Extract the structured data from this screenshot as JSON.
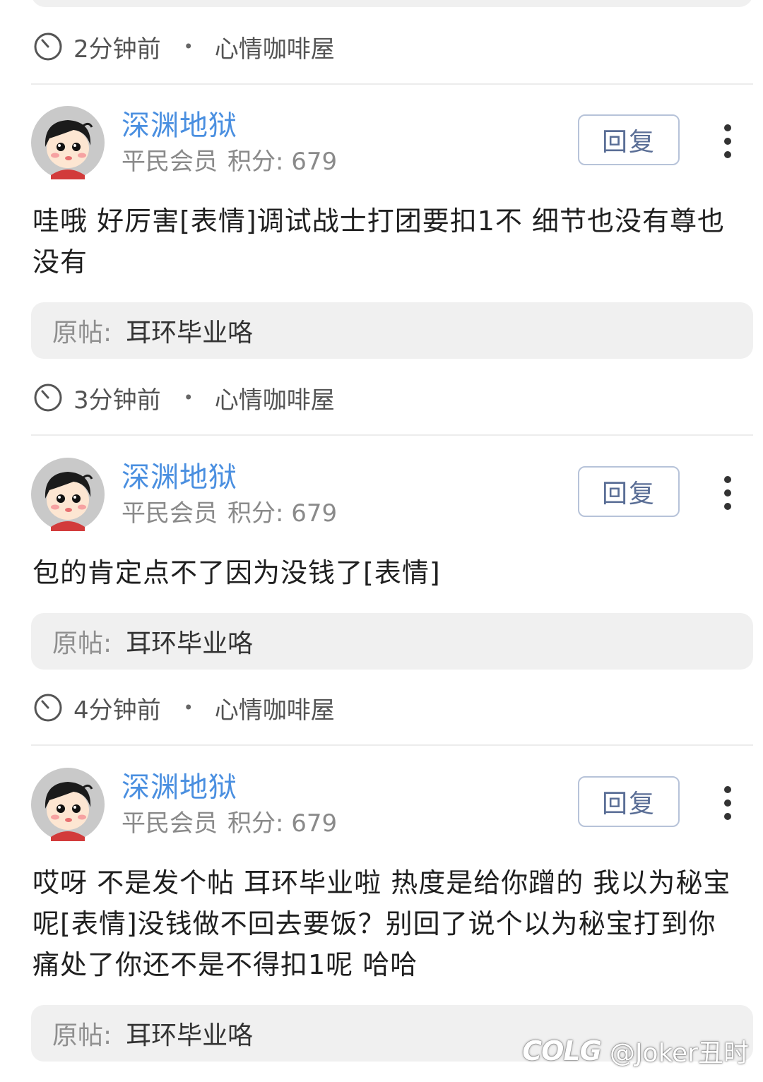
{
  "top": {
    "time": "2分钟前",
    "separator": "•",
    "board": "心情咖啡屋"
  },
  "comments": [
    {
      "username": "深渊地狱",
      "rank": "平民会员",
      "points_label": "积分:",
      "points": "679",
      "reply_label": "回复",
      "body": "哇哦 好厉害[表情]调试战士打团要扣1不 细节也没有尊也没有",
      "original_label": "原帖:",
      "original_title": "耳环毕业咯",
      "time": "3分钟前",
      "separator": "•",
      "board": "心情咖啡屋"
    },
    {
      "username": "深渊地狱",
      "rank": "平民会员",
      "points_label": "积分:",
      "points": "679",
      "reply_label": "回复",
      "body": "包的肯定点不了因为没钱了[表情]",
      "original_label": "原帖:",
      "original_title": "耳环毕业咯",
      "time": "4分钟前",
      "separator": "•",
      "board": "心情咖啡屋"
    },
    {
      "username": "深渊地狱",
      "rank": "平民会员",
      "points_label": "积分:",
      "points": "679",
      "reply_label": "回复",
      "body": "哎呀 不是发个帖 耳环毕业啦 热度是给你蹭的 我以为秘宝呢[表情]没钱做不回去要饭？别回了说个以为秘宝打到你痛处了你还不是不得扣1呢 哈哈",
      "original_label": "原帖:",
      "original_title": "耳环毕业咯"
    }
  ],
  "watermark": {
    "logo": "COLG",
    "handle": "@Joker丑时"
  },
  "icons": {
    "clock": "clock-icon",
    "more": "more-vertical-icon",
    "avatar": "cartoon-boy-avatar"
  },
  "colors": {
    "username": "#4a8fe0",
    "reply_border": "#b7c3d9",
    "card_bg": "#f0f0f0"
  }
}
